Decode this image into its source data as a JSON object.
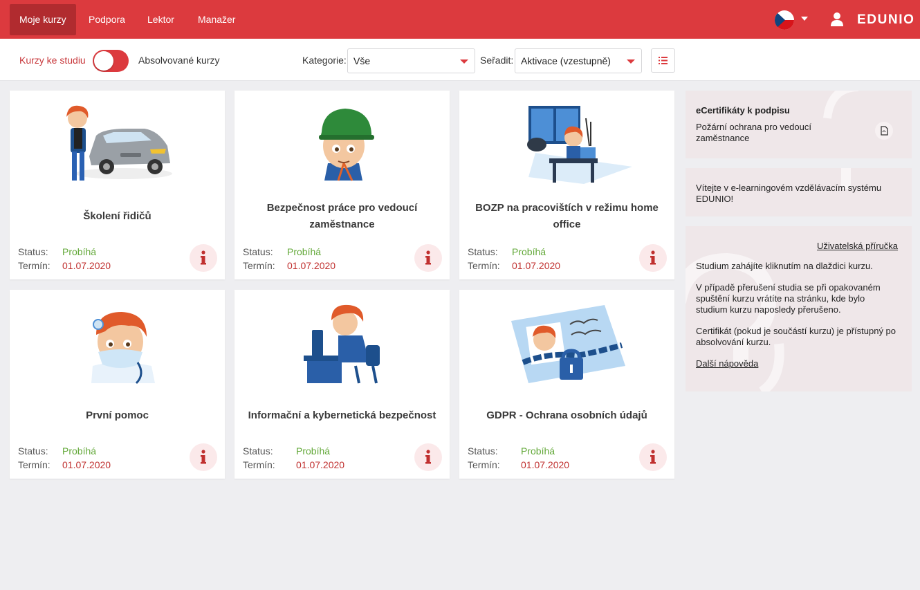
{
  "nav": {
    "items": [
      {
        "label": "Moje kurzy",
        "active": true
      },
      {
        "label": "Podpora",
        "active": false
      },
      {
        "label": "Lektor",
        "active": false
      },
      {
        "label": "Manažer",
        "active": false
      }
    ],
    "logo": "EDUNIO",
    "language_flag": "czech-flag-icon",
    "user_icon": "user-icon"
  },
  "filters": {
    "toggle_left_label": "Kurzy ke studiu",
    "toggle_right_label": "Absolvované kurzy",
    "toggle_on": false,
    "category_label": "Kategorie:",
    "category_value": "Vše",
    "sort_label": "Seřadit:",
    "sort_value": "Aktivace (vzestupně)",
    "list_view_icon": "list-icon"
  },
  "courses": [
    {
      "title": "Školení řidičů",
      "status_label": "Status:",
      "status": "Probíhá",
      "term_label": "Termín:",
      "date": "01.07.2020",
      "illustration": "driver-with-car"
    },
    {
      "title": "Bezpečnost práce pro vedoucí zaměstnance",
      "status_label": "Status:",
      "status": "Probíhá",
      "term_label": "Termín:",
      "date": "01.07.2020",
      "illustration": "worker-helmet"
    },
    {
      "title": "BOZP na pracovištích v režimu home office",
      "status_label": "Status:",
      "status": "Probíhá",
      "term_label": "Termín:",
      "date": "01.07.2020",
      "illustration": "home-office-desk"
    },
    {
      "title": "První pomoc",
      "status_label": "Status:",
      "status": "Probíhá",
      "term_label": "Termín:",
      "date": "01.07.2020",
      "illustration": "doctor-mask"
    },
    {
      "title": "Informační a kybernetická bezpečnost",
      "status_label": "Status:",
      "status": "Probíhá",
      "term_label": "Termín:",
      "date": "01.07.2020",
      "illustration": "computer-user"
    },
    {
      "title": "GDPR - Ochrana osobních údajů",
      "status_label": "Status:",
      "status": "Probíhá",
      "term_label": "Termín:",
      "date": "01.07.2020",
      "illustration": "id-card-lock"
    }
  ],
  "sidebar": {
    "certificates": {
      "title": "eCertifikáty k podpisu",
      "item": "Požární ochrana pro vedoucí zaměstnance",
      "icon": "pdf-icon"
    },
    "welcome": "Vítejte v e-learningovém vzdělávacím systému EDUNIO!",
    "help": {
      "manual_link": "Uživatelská příručka",
      "p1": "Studium zahájíte kliknutím na dlaždici kurzu.",
      "p2": "V případě přerušení studia se při opakovaném spuštění kurzu vrátíte na stránku, kde bylo studium kurzu naposledy přerušeno.",
      "p3": "Certifikát (pokud je součástí kurzu) je přístupný po absolvování kurzu.",
      "more_link": "Další nápověda"
    }
  },
  "colors": {
    "brand": "#dc3a3e",
    "status_ok": "#62a838",
    "date": "#c0302f"
  }
}
